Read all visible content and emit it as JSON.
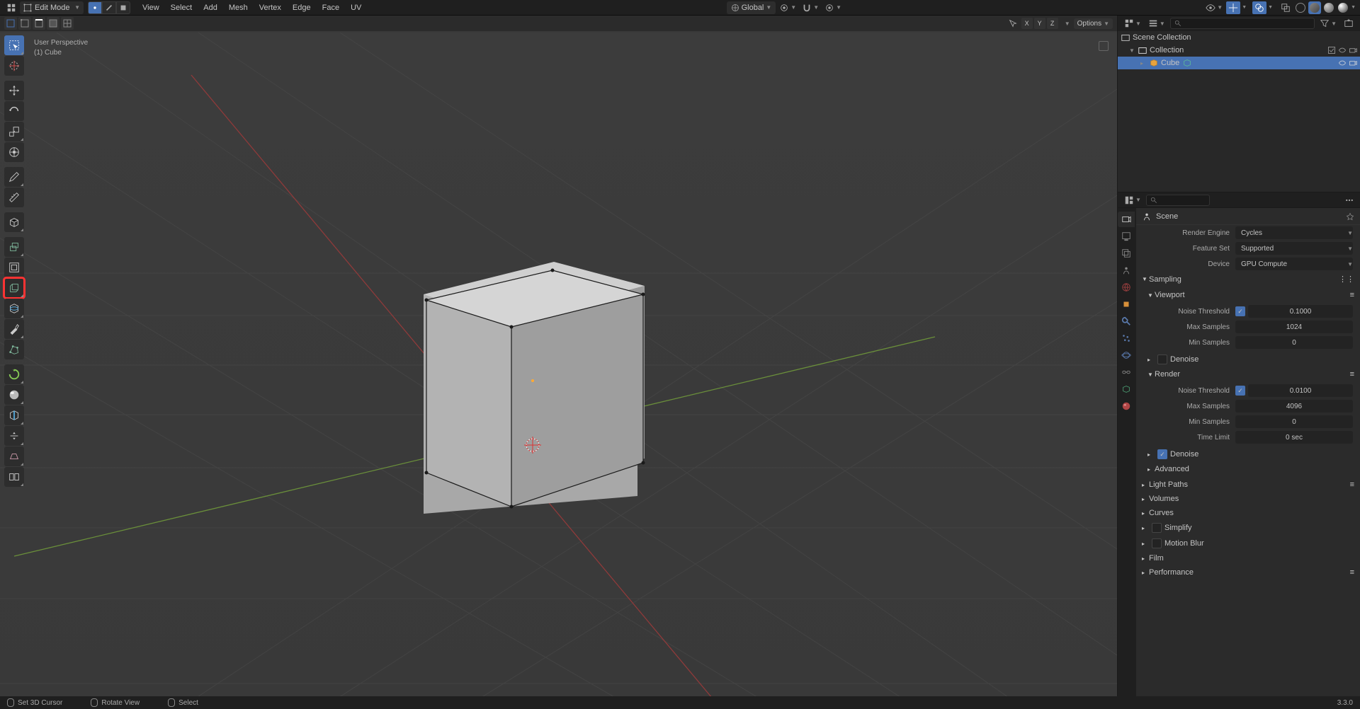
{
  "header": {
    "mode": "Edit Mode",
    "menus": [
      "View",
      "Select",
      "Add",
      "Mesh",
      "Vertex",
      "Edge",
      "Face",
      "UV"
    ],
    "transform_orientation": "Global"
  },
  "second_header": {
    "options_label": "Options"
  },
  "viewport": {
    "perspective": "User Perspective",
    "object_info": "(1) Cube",
    "axes": [
      "X",
      "Y",
      "Z"
    ]
  },
  "outliner": {
    "scene_collection": "Scene Collection",
    "collection": "Collection",
    "cube": "Cube",
    "search_placeholder": ""
  },
  "properties": {
    "scene_label": "Scene",
    "render_engine": {
      "label": "Render Engine",
      "value": "Cycles"
    },
    "feature_set": {
      "label": "Feature Set",
      "value": "Supported"
    },
    "device": {
      "label": "Device",
      "value": "GPU Compute"
    },
    "panels": {
      "sampling": "Sampling",
      "viewport": "Viewport",
      "render": "Render",
      "denoise": "Denoise",
      "advanced": "Advanced",
      "light_paths": "Light Paths",
      "volumes": "Volumes",
      "curves": "Curves",
      "simplify": "Simplify",
      "motion_blur": "Motion Blur",
      "film": "Film",
      "performance": "Performance"
    },
    "viewport_section": {
      "noise_threshold": {
        "label": "Noise Threshold",
        "value": "0.1000",
        "checked": true
      },
      "max_samples": {
        "label": "Max Samples",
        "value": "1024"
      },
      "min_samples": {
        "label": "Min Samples",
        "value": "0"
      }
    },
    "render_section": {
      "noise_threshold": {
        "label": "Noise Threshold",
        "value": "0.0100",
        "checked": true
      },
      "max_samples": {
        "label": "Max Samples",
        "value": "4096"
      },
      "min_samples": {
        "label": "Min Samples",
        "value": "0"
      },
      "time_limit": {
        "label": "Time Limit",
        "value": "0 sec"
      }
    }
  },
  "status_bar": {
    "cursor": "Set 3D Cursor",
    "rotate": "Rotate View",
    "select": "Select",
    "version": "3.3.0"
  }
}
